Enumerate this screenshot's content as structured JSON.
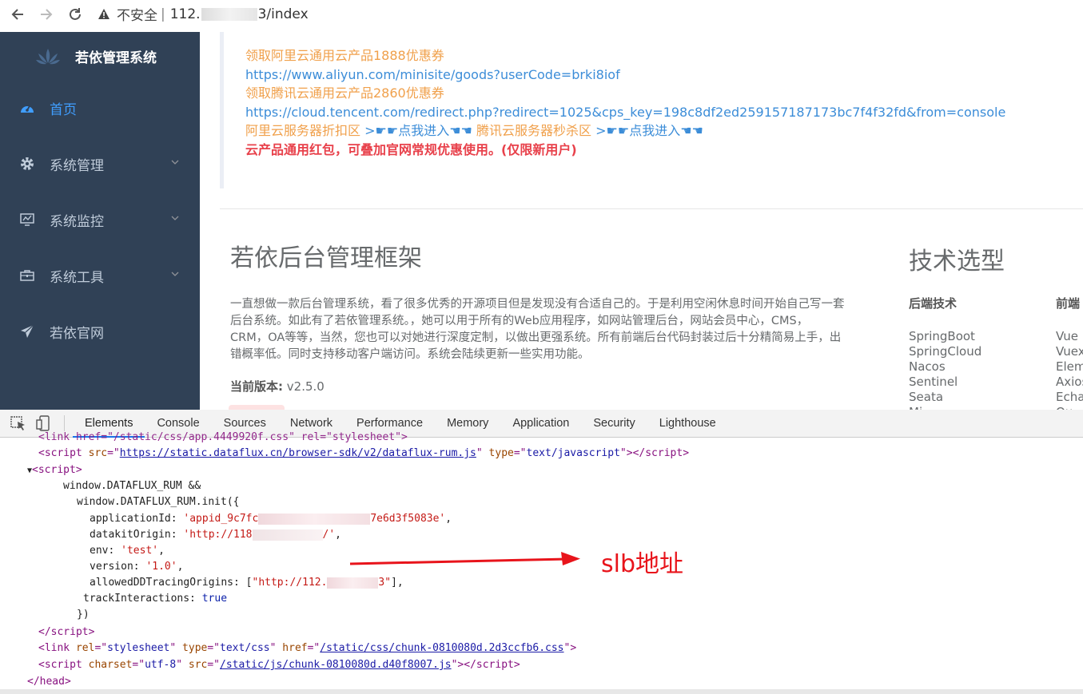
{
  "browser": {
    "security_label": "不安全",
    "url_prefix": "112.",
    "url_suffix": "3/index"
  },
  "sidebar": {
    "title": "若依管理系统",
    "items": [
      {
        "label": "首页",
        "icon": "dashboard-icon",
        "active": true
      },
      {
        "label": "系统管理",
        "icon": "gear-icon",
        "expandable": true
      },
      {
        "label": "系统监控",
        "icon": "monitor-icon",
        "expandable": true
      },
      {
        "label": "系统工具",
        "icon": "toolbox-icon",
        "expandable": true
      },
      {
        "label": "若依官网",
        "icon": "paper-plane-icon"
      }
    ]
  },
  "notice": {
    "line1": "领取阿里云通用云产品1888优惠券",
    "line2": "https://www.aliyun.com/minisite/goods?userCode=brki8iof",
    "line3": "领取腾讯云通用云产品2860优惠券",
    "line4": "https://cloud.tencent.com/redirect.php?redirect=1025&cps_key=198c8df2ed259157187173bc7f4f32fd&from=console",
    "aliyun_label": "阿里云服务器折扣区",
    "aliyun_link": ">☛☛点我进入☚☚",
    "tencent_label": "腾讯云服务器秒杀区",
    "tencent_link": ">☛☛点我进入☚☚",
    "red_line": "云产品通用红包，可叠加官网常规优惠使用。(仅限新用户)"
  },
  "framework": {
    "title": "若依后台管理框架",
    "description": "一直想做一款后台管理系统，看了很多优秀的开源项目但是发现没有合适自己的。于是利用空闲休息时间开始自己写一套后台系统。如此有了若依管理系统。，她可以用于所有的Web应用程序，如网站管理后台，网站会员中心，CMS，CRM，OA等等，当然，您也可以对她进行深度定制，以做出更强系统。所有前端后台代码封装过后十分精简易上手，出错概率低。同时支持移动客户端访问。系统会陆续更新一些实用功能。",
    "version_label": "当前版本:",
    "version_value": "v2.5.0"
  },
  "tech": {
    "title": "技术选型",
    "backend_header": "后端技术",
    "backend": [
      "SpringBoot",
      "SpringCloud",
      "Nacos",
      "Sentinel",
      "Seata",
      "Mi"
    ],
    "frontend_header": "前端",
    "frontend": [
      "Vue",
      "Vuex",
      "Elem",
      "Axios",
      "Echa",
      "Qu"
    ]
  },
  "devtools": {
    "tabs": [
      "Elements",
      "Console",
      "Sources",
      "Network",
      "Performance",
      "Memory",
      "Application",
      "Security",
      "Lighthouse"
    ],
    "active_tab": "Elements",
    "code": {
      "line0_text": "<link href=\"/static/css/app.4449920f.css\" rel=\"stylesheet\">",
      "script_src": "https://static.dataflux.cn/browser-sdk/v2/dataflux-rum.js",
      "script_type": "text/javascript",
      "l_window": "window.DATAFLUX_RUM &&",
      "l_init": "window.DATAFLUX_RUM.init({",
      "app_id_key": "applicationId: ",
      "app_id_start": "'appid_9c7fc",
      "app_id_end": "7e6d3f5083e'",
      "datakit_key": "datakitOrigin: ",
      "datakit_start": "'http://118",
      "datakit_end": "/'",
      "env_key": "env: ",
      "env_val": "'test'",
      "version_key": "version: ",
      "version_val": "'1.0'",
      "allowed_key": "allowedDDTracingOrigins: [",
      "allowed_start": "\"http://112.",
      "allowed_end": "3\"",
      "track_key": "trackInteractions: ",
      "track_val": "true",
      "close_brace": "})",
      "css_href": "/static/css/chunk-0810080d.2d3ccfb6.css",
      "js_src": "/static/js/chunk-0810080d.d40f8007.js"
    }
  },
  "annotation": "slb地址",
  "colors": {
    "sidebar_bg": "#304156",
    "active_menu": "#409eff",
    "orange": "#f0a04b",
    "link": "#3c8dd8",
    "red": "#e8414b",
    "annotation_red": "#e8141b"
  }
}
